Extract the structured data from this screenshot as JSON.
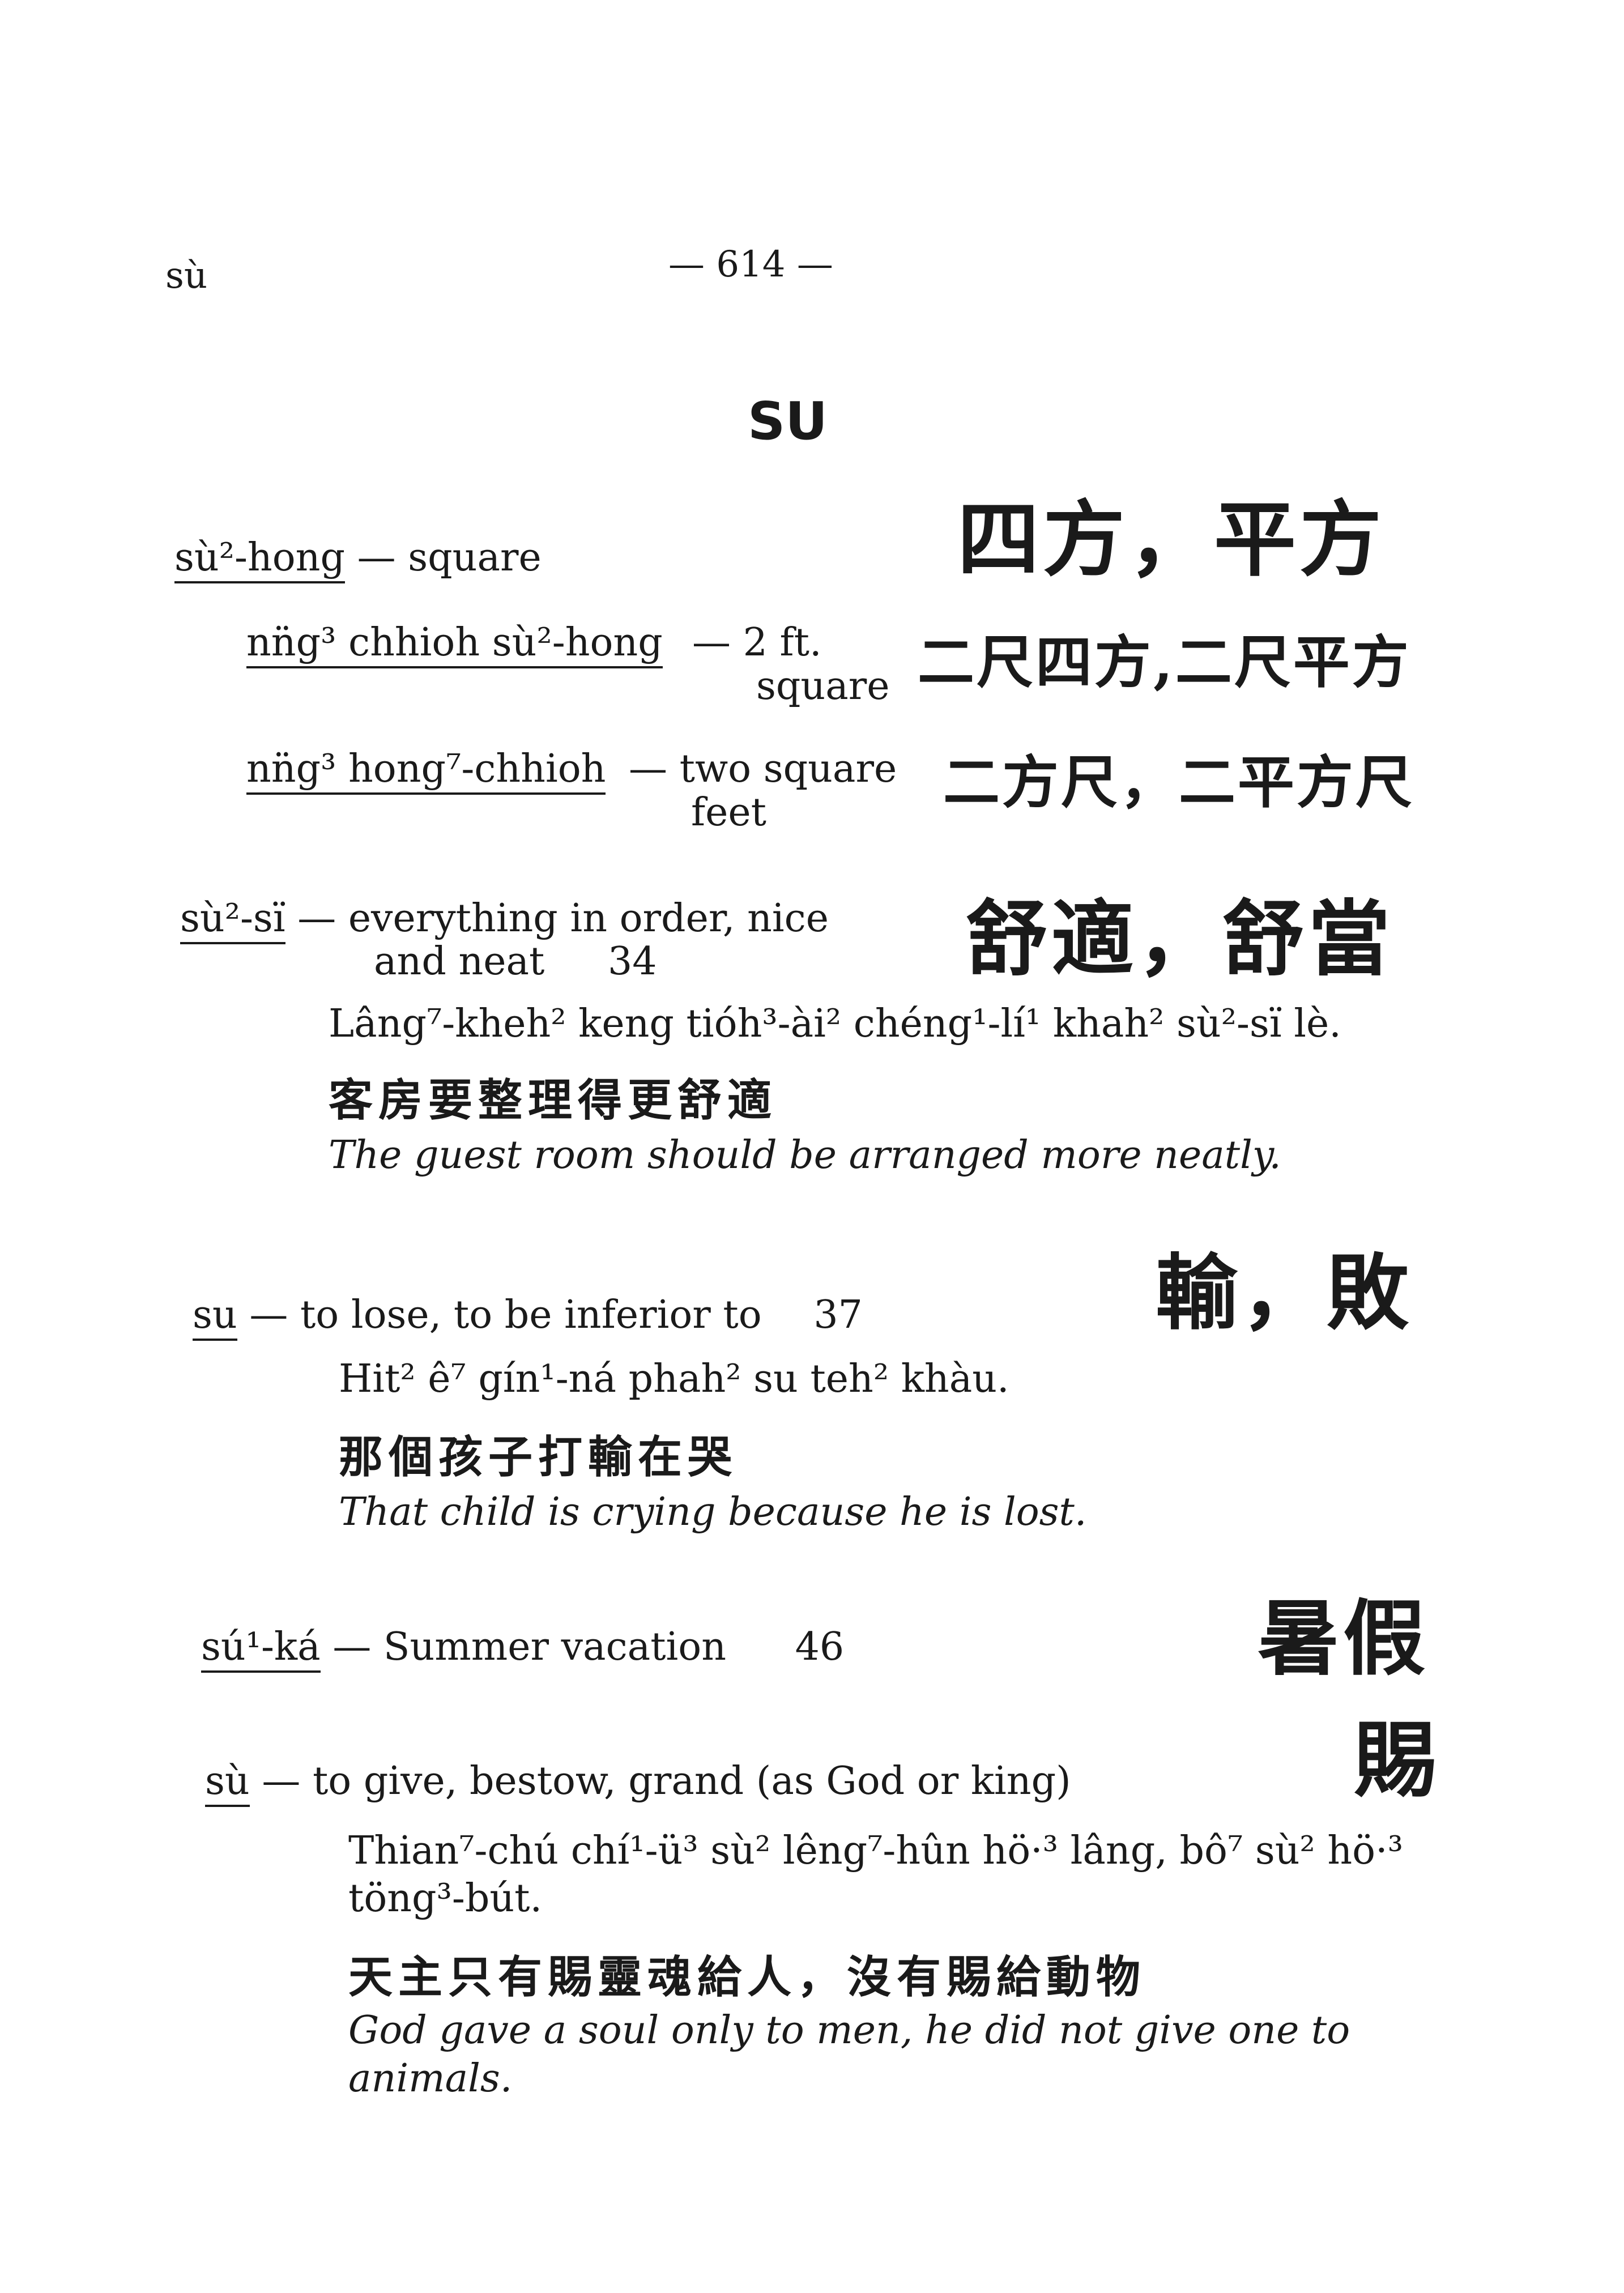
{
  "header": {
    "running_head": "sù",
    "page_number": "— 614 —"
  },
  "section": "SU",
  "entries": {
    "e1": {
      "term": "sù²-hong",
      "def": "— square",
      "chinese": "四方，平方",
      "sub1": {
        "term": "nn̈g³ chhioh sù²-hong",
        "def1": "— 2 ft.",
        "def2": "square",
        "chinese": "二尺四方,二尺平方"
      },
      "sub2": {
        "term": "nn̈g³ hong⁷-chhioh",
        "def1": "— two square",
        "def2": "feet",
        "chinese": "二方尺，二平方尺"
      }
    },
    "e2": {
      "term": "sù²-sï",
      "def1": "— everything in order, nice",
      "def2": "and neat",
      "lesson": "34",
      "chinese": "舒適，舒當",
      "example": "Lâng⁷-kheh² keng tióh³-ài² chéng¹-lí¹ khah² sù²-sï lè.",
      "example_cn": "客房要整理得更舒適",
      "translation": "The guest room should be arranged more neatly."
    },
    "e3": {
      "term": "su",
      "def": "— to lose, to be inferior to",
      "lesson": "37",
      "chinese": "輸，敗",
      "example": "Hit² ê⁷ gín¹-ná phah² su teh² khàu.",
      "example_cn": "那個孩子打輸在哭",
      "translation": "That child is crying because he is lost."
    },
    "e4": {
      "term": "sú¹-ká",
      "def": "— Summer vacation",
      "lesson": "46",
      "chinese": "暑假"
    },
    "e5": {
      "term": "sù",
      "def": "— to give, bestow, grand (as God or king)",
      "chinese": "賜",
      "example1": "Thian⁷-chú chí¹-ü³ sù² lêng⁷-hûn hö·³ lâng, bô⁷ sù² hö·³",
      "example2": "töng³-bút.",
      "example_cn": "天主只有賜靈魂給人，沒有賜給動物",
      "translation1": "God gave a soul only to men, he did not give one to",
      "translation2": "animals."
    }
  }
}
